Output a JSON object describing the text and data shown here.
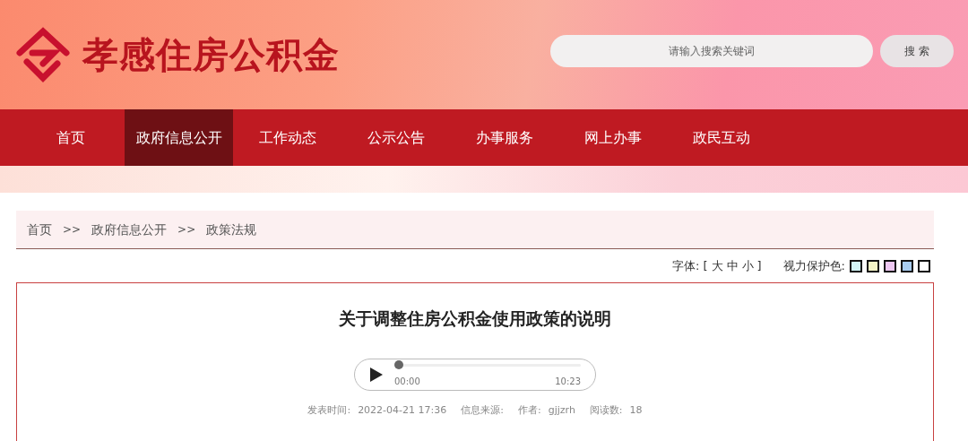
{
  "header": {
    "site_name": "孝感住房公积金",
    "search": {
      "placeholder": "请输入搜索关键词",
      "button": "搜 索"
    }
  },
  "nav": [
    {
      "label": "首页",
      "selected": false
    },
    {
      "label": "政府信息公开",
      "selected": true
    },
    {
      "label": "工作动态",
      "selected": false
    },
    {
      "label": "公示公告",
      "selected": false
    },
    {
      "label": "办事服务",
      "selected": false
    },
    {
      "label": "网上办事",
      "selected": false
    },
    {
      "label": "政民互动",
      "selected": false
    }
  ],
  "breadcrumb": [
    {
      "label": "首页"
    },
    {
      "label": "政府信息公开"
    },
    {
      "label": "政策法规"
    }
  ],
  "breadcrumb_separator": ">>",
  "font_size": {
    "label": "字体:",
    "open": "[",
    "options": [
      "大",
      "中",
      "小"
    ],
    "close": "]"
  },
  "eye_care": {
    "label": "视力保护色:",
    "swatches": [
      {
        "color": "#d2f4f6"
      },
      {
        "color": "#f3f3c6"
      },
      {
        "color": "#eec8f2"
      },
      {
        "color": "#a9cdf0"
      },
      {
        "color": "#ffffff"
      }
    ]
  },
  "article": {
    "title": "关于调整住房公积金使用政策的说明",
    "audio": {
      "current": "00:00",
      "duration": "10:23",
      "level": 0
    },
    "meta": [
      {
        "label": "发表时间:",
        "value": "2022-04-21 17:36"
      },
      {
        "label": "信息来源:"
      },
      {
        "label": "作者:",
        "value": "gjjzrh"
      },
      {
        "label": "阅读数:",
        "value": "18"
      }
    ]
  }
}
